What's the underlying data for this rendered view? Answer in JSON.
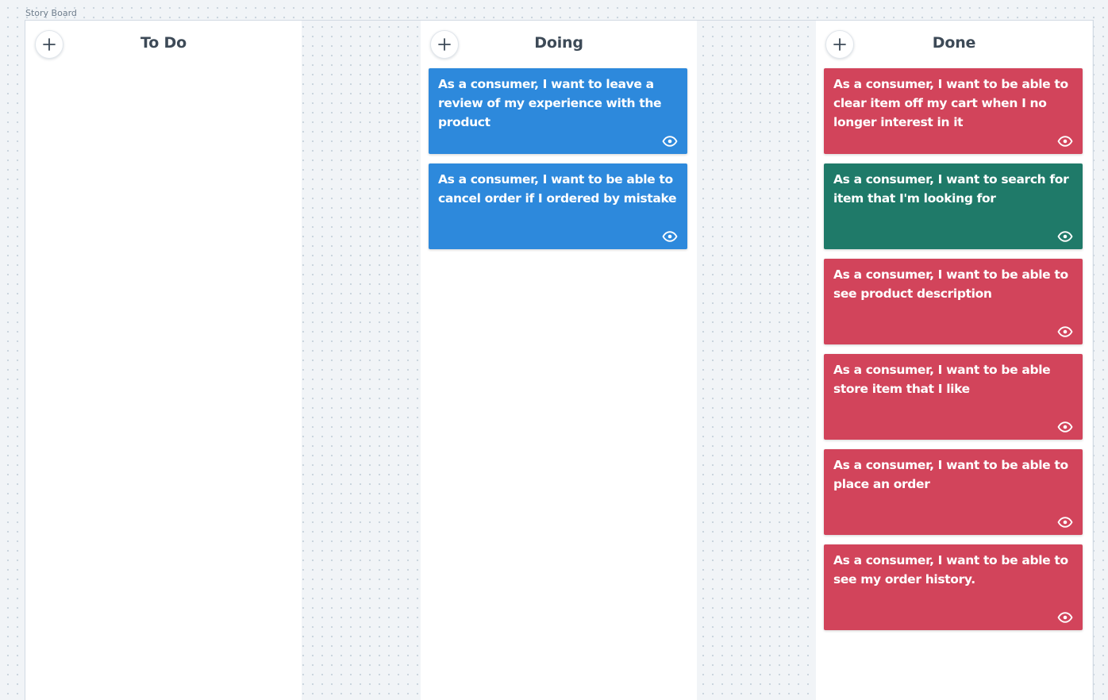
{
  "board": {
    "label": "Story Board"
  },
  "colors": {
    "blue_card": "#2d89dc",
    "red_card": "#d2445b",
    "green_card": "#1f7a69",
    "header_text": "#3d4a57"
  },
  "columns": [
    {
      "title": "To Do",
      "add_icon": "plus-icon",
      "cards": []
    },
    {
      "title": "Doing",
      "add_icon": "plus-icon",
      "cards": [
        {
          "text": "As a consumer, I want to leave a review of my experience with the product",
          "color": "blue",
          "icon": "eye-icon"
        },
        {
          "text": "As a consumer, I want to be able to cancel order if I ordered by mistake",
          "color": "blue",
          "icon": "eye-icon"
        }
      ]
    },
    {
      "title": "Done",
      "add_icon": "plus-icon",
      "cards": [
        {
          "text": "As a consumer, I want to be able to clear item off my cart when I no longer interest in it",
          "color": "red",
          "icon": "eye-icon"
        },
        {
          "text": "As a consumer, I want to search for item that I'm looking for",
          "color": "green",
          "icon": "eye-icon"
        },
        {
          "text": "As a consumer, I want to be able to see product description",
          "color": "red",
          "icon": "eye-icon"
        },
        {
          "text": "As a consumer, I want to be able store item that I like",
          "color": "red",
          "icon": "eye-icon"
        },
        {
          "text": "As a consumer, I want to be able to place an order",
          "color": "red",
          "icon": "eye-icon"
        },
        {
          "text": "As a consumer, I want to be able to see my order history.",
          "color": "red",
          "icon": "eye-icon"
        }
      ]
    }
  ]
}
